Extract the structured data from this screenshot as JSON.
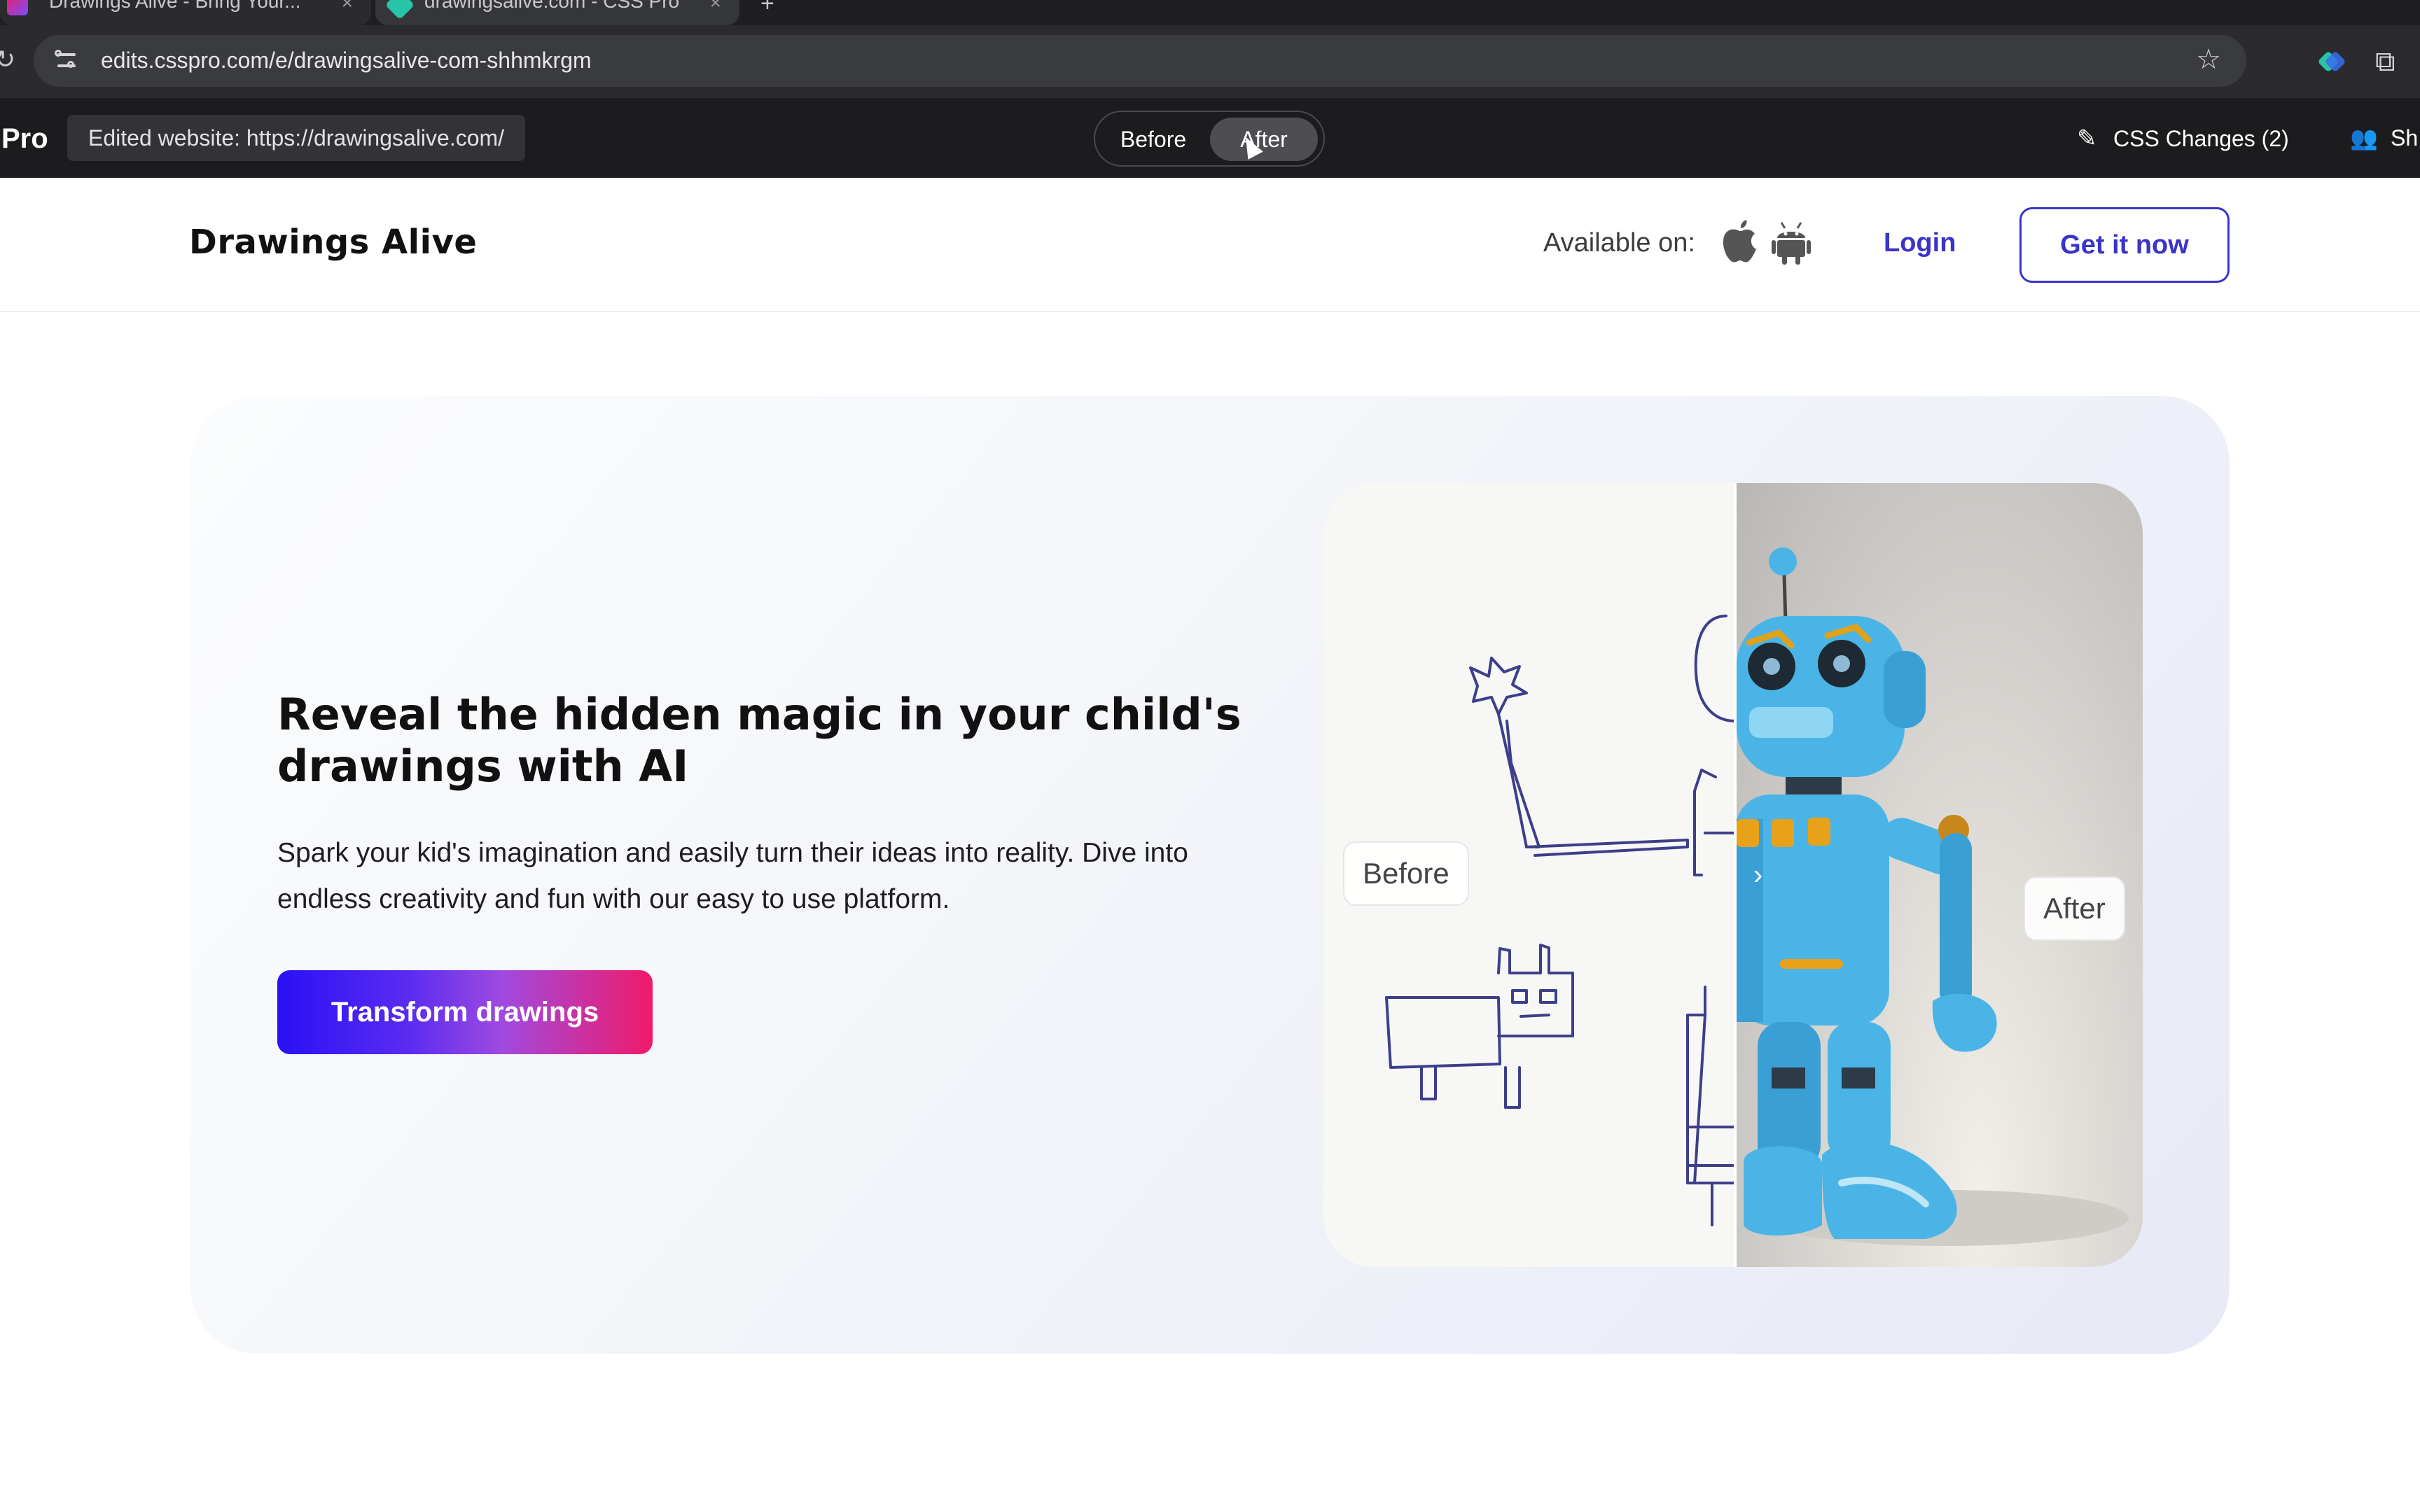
{
  "browser": {
    "tabs": [
      {
        "title": "Drawings Alive - Bring Your..."
      },
      {
        "title": "drawingsalive.com - CSS Pro"
      }
    ],
    "url": "edits.csspro.com/e/drawingsalive-com-shhmkrgm"
  },
  "csspro": {
    "brand": "Pro",
    "edited_label": "Edited website: https://drawingsalive.com/",
    "toggle": {
      "before": "Before",
      "after": "After",
      "selected": "After"
    },
    "css_changes": "CSS Changes (2)",
    "share": "Sh"
  },
  "site": {
    "logo": "Drawings Alive",
    "available_on": "Available on:",
    "platform_icons": [
      "apple-icon",
      "android-icon"
    ],
    "login": "Login",
    "get_it_now": "Get it now"
  },
  "hero": {
    "headline": "Reveal the hidden magic in your child's drawings with AI",
    "subtext": "Spark your kid's imagination and easily turn their ideas into reality. Dive into endless creativity and fun with our easy to use platform.",
    "cta": "Transform drawings",
    "compare": {
      "before_label": "Before",
      "after_label": "After"
    }
  },
  "colors": {
    "accent": "#3a34c8",
    "cta_gradient_start": "#2a10f5",
    "cta_gradient_end": "#f01a6a",
    "robot_blue": "#4bb4e6"
  }
}
